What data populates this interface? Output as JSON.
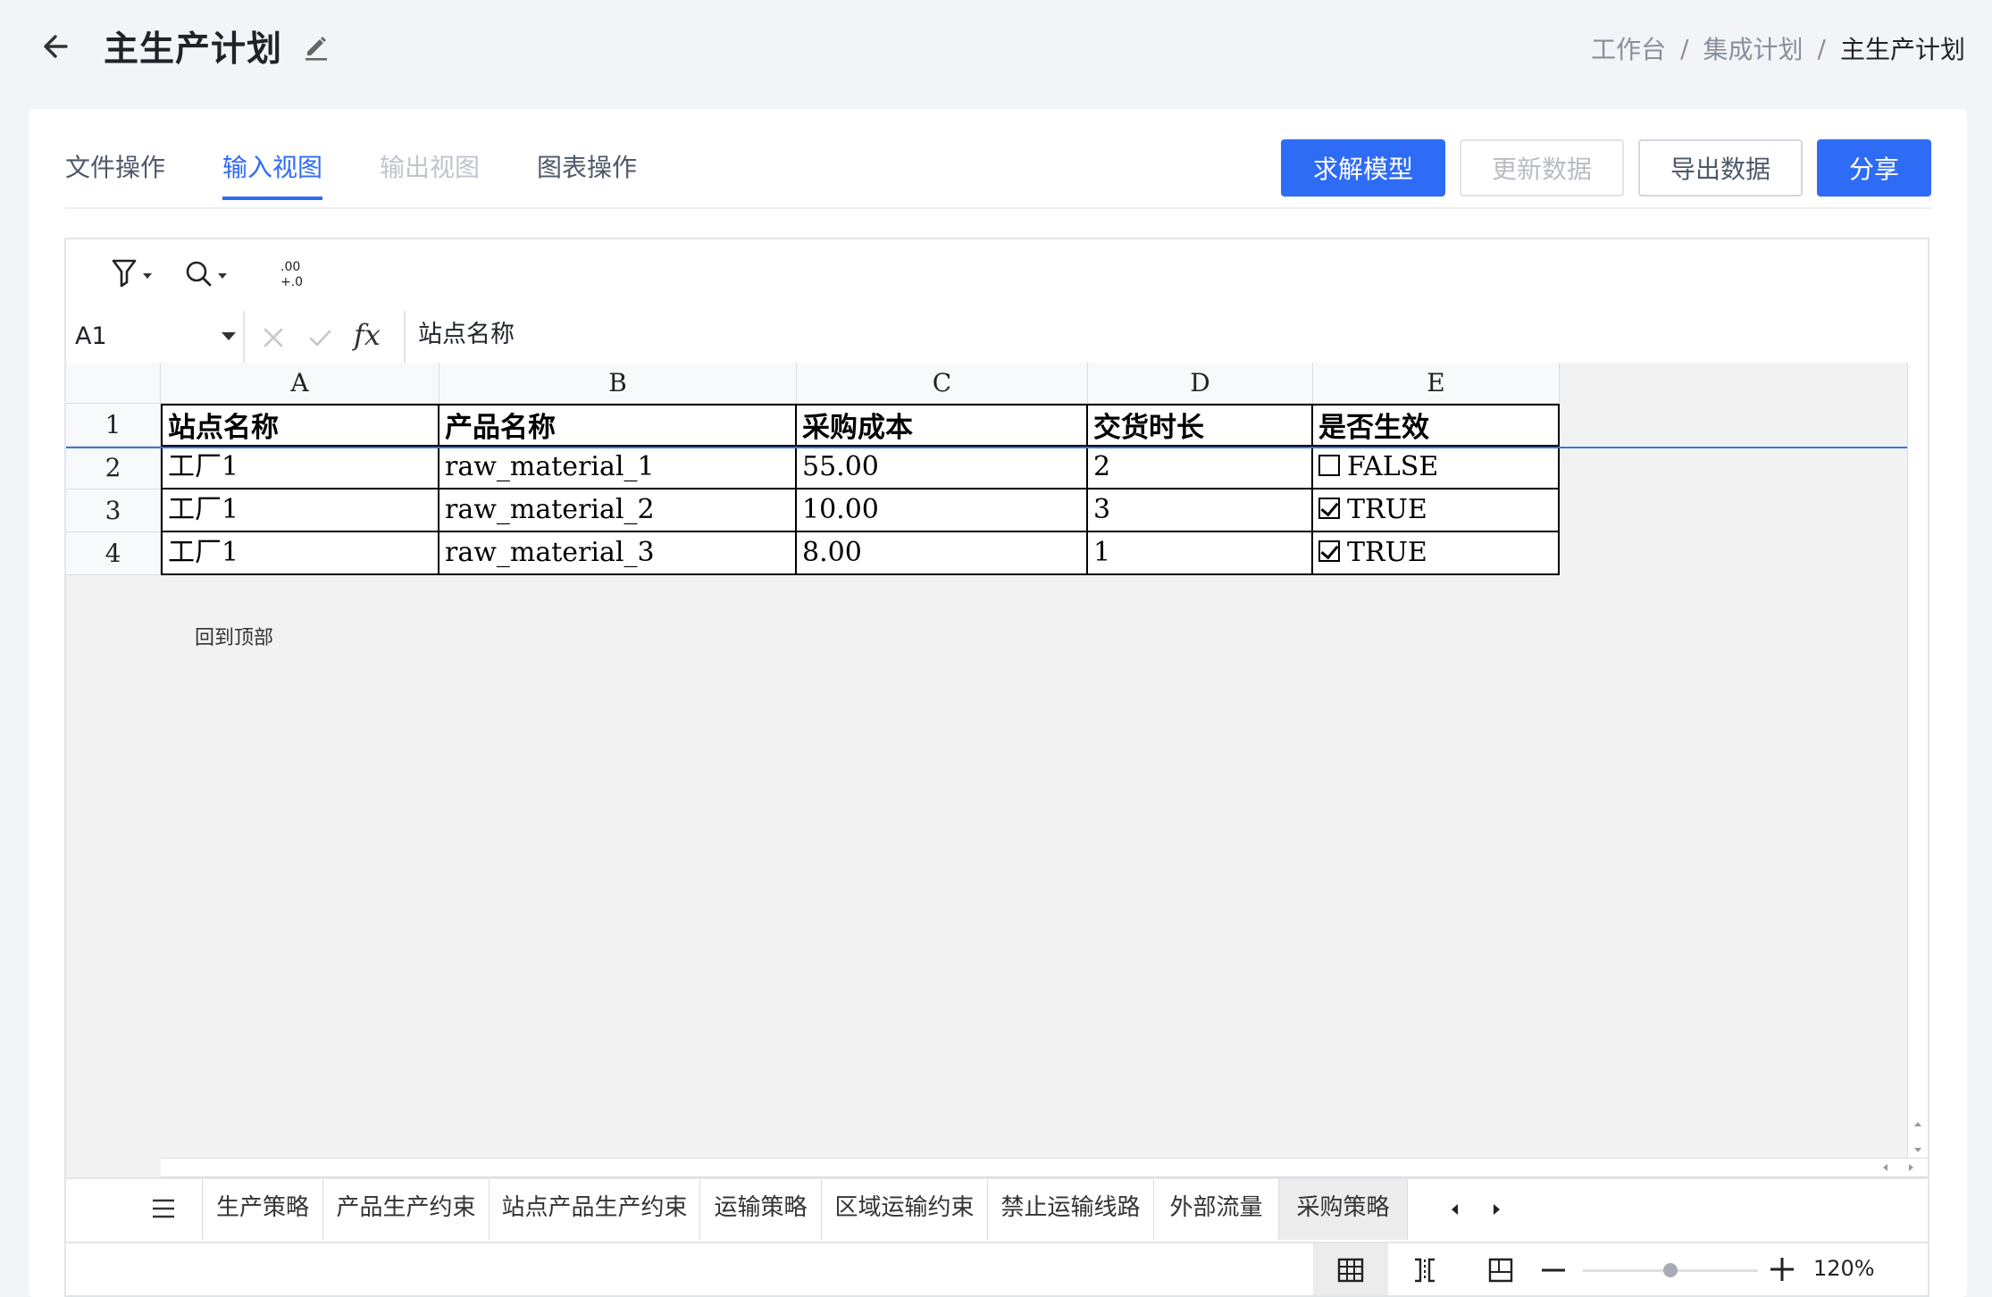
{
  "header": {
    "title": "主生产计划",
    "breadcrumb": [
      "工作台",
      "集成计划",
      "主生产计划"
    ]
  },
  "tabs": [
    {
      "label": "文件操作",
      "state": "normal"
    },
    {
      "label": "输入视图",
      "state": "active"
    },
    {
      "label": "输出视图",
      "state": "disabled"
    },
    {
      "label": "图表操作",
      "state": "normal"
    }
  ],
  "actions": {
    "solve": "求解模型",
    "update": "更新数据",
    "export": "导出数据",
    "share": "分享"
  },
  "formula_bar": {
    "cell_ref": "A1",
    "fx": "fx",
    "content": "站点名称"
  },
  "toolbar": {
    "decimal_label_top": ".00",
    "decimal_label_bottom": "+.0"
  },
  "grid": {
    "columns": [
      "A",
      "B",
      "C",
      "D",
      "E"
    ],
    "rows": [
      "1",
      "2",
      "3",
      "4"
    ],
    "header": [
      "站点名称",
      "产品名称",
      "采购成本",
      "交货时长",
      "是否生效"
    ],
    "data": [
      {
        "site": "工厂1",
        "product": "raw_material_1",
        "cost": "55.00",
        "lead": "2",
        "active": "FALSE",
        "checked": false
      },
      {
        "site": "工厂1",
        "product": "raw_material_2",
        "cost": "10.00",
        "lead": "3",
        "active": "TRUE",
        "checked": true
      },
      {
        "site": "工厂1",
        "product": "raw_material_3",
        "cost": "8.00",
        "lead": "1",
        "active": "TRUE",
        "checked": true
      }
    ],
    "back_to_top": "回到顶部"
  },
  "sheet_tabs": [
    "生产策略",
    "产品生产约束",
    "站点产品生产约束",
    "运输策略",
    "区域运输约束",
    "禁止运输线路",
    "外部流量",
    "采购策略"
  ],
  "active_sheet": "采购策略",
  "status": {
    "zoom": "120%",
    "zoom_level": 0.5
  },
  "colors": {
    "accent": "#2f6cf6",
    "freeze_line": "#3b73e8"
  }
}
